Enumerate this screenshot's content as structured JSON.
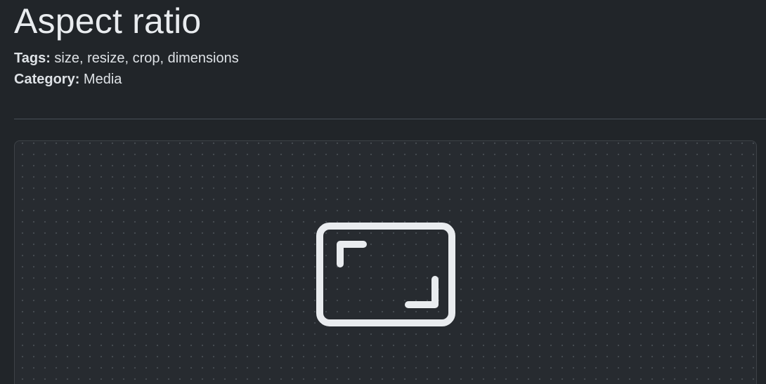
{
  "page": {
    "title": "Aspect ratio",
    "tags_label": "Tags:",
    "tags_value": "size, resize, crop, dimensions",
    "category_label": "Category:",
    "category_value": "Media"
  },
  "preview": {
    "icon": "aspect-ratio-icon",
    "icon_color": "#e9ecef",
    "background": "dotted-grid"
  }
}
